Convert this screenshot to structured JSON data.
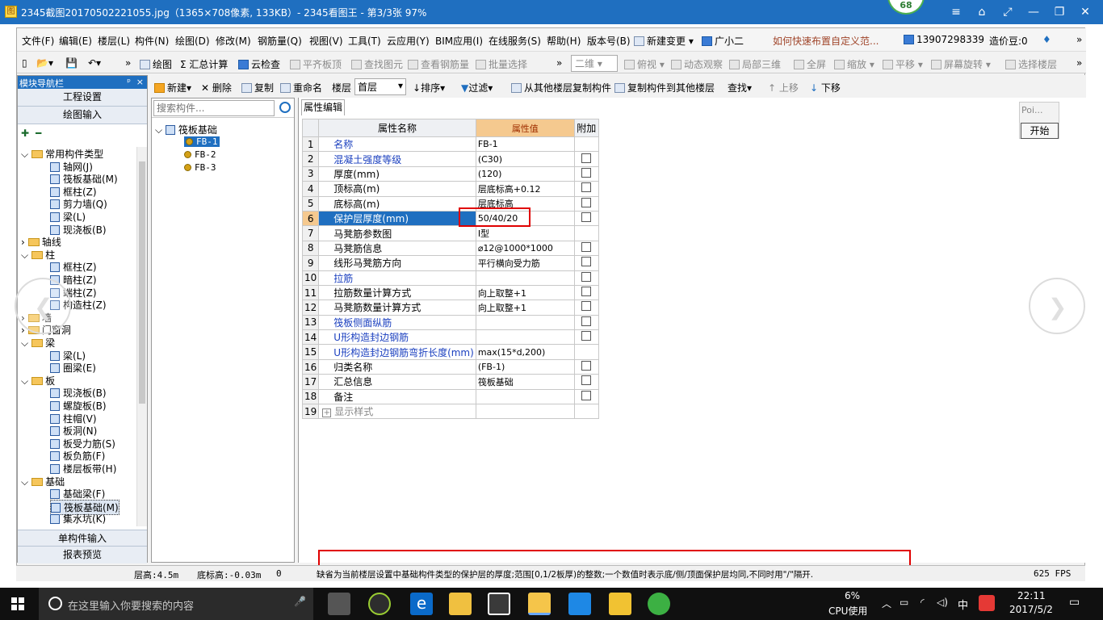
{
  "viewer": {
    "title": "2345截图20170502221055.jpg（1365×708像素, 133KB）- 2345看图王 - 第3/3张 97%",
    "badge": "68",
    "controls": [
      "≡",
      "⌂",
      "⤢",
      "—",
      "❐",
      "✕"
    ]
  },
  "menubar": {
    "items": [
      "文件(F)",
      "编辑(E)",
      "楼层(L)",
      "构件(N)",
      "绘图(D)",
      "修改(M)",
      "钢筋量(Q)",
      "视图(V)",
      "工具(T)",
      "云应用(Y)",
      "BIM应用(I)",
      "在线服务(S)",
      "帮助(H)",
      "版本号(B)"
    ],
    "new_change": "新建变更",
    "assistant": "广小二",
    "tip_link": "如何快速布置自定义范...",
    "phone": "13907298339",
    "coins": "造价豆:0"
  },
  "toolbar1": {
    "items": [
      "绘图",
      "Σ 汇总计算",
      "云检查",
      "平齐板顶",
      "查找图元",
      "查看钢筋量",
      "批量选择"
    ],
    "view_select": "二维",
    "view_items": [
      "俯视",
      "动态观察",
      "局部三维",
      "全屏",
      "缩放",
      "平移",
      "屏幕旋转",
      "选择楼层"
    ]
  },
  "nav": {
    "title": "模块导航栏",
    "pin": "ᵖ",
    "close": "×",
    "btn_project": "工程设置",
    "btn_draw": "绘图输入",
    "tree": [
      {
        "label": "常用构件类型",
        "kind": "folder",
        "level": 0,
        "toggle": "⌵"
      },
      {
        "label": "轴网(J)",
        "kind": "item",
        "level": 1
      },
      {
        "label": "筏板基础(M)",
        "kind": "item",
        "level": 1
      },
      {
        "label": "框柱(Z)",
        "kind": "item",
        "level": 1
      },
      {
        "label": "剪力墙(Q)",
        "kind": "item",
        "level": 1
      },
      {
        "label": "梁(L)",
        "kind": "item",
        "level": 1
      },
      {
        "label": "现浇板(B)",
        "kind": "item",
        "level": 1
      },
      {
        "label": "轴线",
        "kind": "folder",
        "level": 0,
        "toggle": "›"
      },
      {
        "label": "柱",
        "kind": "folder",
        "level": 0,
        "toggle": "⌵"
      },
      {
        "label": "框柱(Z)",
        "kind": "item",
        "level": 1
      },
      {
        "label": "暗柱(Z)",
        "kind": "item",
        "level": 1
      },
      {
        "label": "端柱(Z)",
        "kind": "item",
        "level": 1
      },
      {
        "label": "构造柱(Z)",
        "kind": "item",
        "level": 1
      },
      {
        "label": "墙",
        "kind": "folder",
        "level": 0,
        "toggle": "›"
      },
      {
        "label": "门窗洞",
        "kind": "folder",
        "level": 0,
        "toggle": "›"
      },
      {
        "label": "梁",
        "kind": "folder",
        "level": 0,
        "toggle": "⌵"
      },
      {
        "label": "梁(L)",
        "kind": "item",
        "level": 1
      },
      {
        "label": "圈梁(E)",
        "kind": "item",
        "level": 1
      },
      {
        "label": "板",
        "kind": "folder",
        "level": 0,
        "toggle": "⌵"
      },
      {
        "label": "现浇板(B)",
        "kind": "item",
        "level": 1
      },
      {
        "label": "螺旋板(B)",
        "kind": "item",
        "level": 1
      },
      {
        "label": "柱帽(V)",
        "kind": "item",
        "level": 1
      },
      {
        "label": "板洞(N)",
        "kind": "item",
        "level": 1
      },
      {
        "label": "板受力筋(S)",
        "kind": "item",
        "level": 1
      },
      {
        "label": "板负筋(F)",
        "kind": "item",
        "level": 1
      },
      {
        "label": "楼层板带(H)",
        "kind": "item",
        "level": 1
      },
      {
        "label": "基础",
        "kind": "folder",
        "level": 0,
        "toggle": "⌵"
      },
      {
        "label": "基础梁(F)",
        "kind": "item",
        "level": 1
      },
      {
        "label": "筏板基础(M)",
        "kind": "item",
        "level": 1,
        "selected": true
      },
      {
        "label": "集水坑(K)",
        "kind": "item",
        "level": 1
      }
    ],
    "btn_single": "单构件输入",
    "btn_report": "报表预览"
  },
  "toolbar2": {
    "items": [
      "新建",
      "删除",
      "复制",
      "重命名"
    ],
    "floor_label": "楼层",
    "floor_value": "首层",
    "sort": "排序",
    "filter": "过滤",
    "copy_from": "从其他楼层复制构件",
    "copy_to": "复制构件到其他楼层",
    "find": "查找",
    "up": "上移",
    "down": "下移"
  },
  "component_list": {
    "search_placeholder": "搜索构件...",
    "root": "筏板基础",
    "items": [
      "FB-1",
      "FB-2",
      "FB-3"
    ]
  },
  "props": {
    "tab": "属性编辑",
    "headers": [
      "属性名称",
      "属性值",
      "附加"
    ],
    "rows": [
      {
        "n": "1",
        "name": "名称",
        "value": "FB-1",
        "blue": true,
        "cb": false
      },
      {
        "n": "2",
        "name": "混凝土强度等级",
        "value": "(C30)",
        "blue": true,
        "cb": true
      },
      {
        "n": "3",
        "name": "厚度(mm)",
        "value": "(120)",
        "blue": false,
        "cb": true
      },
      {
        "n": "4",
        "name": "顶标高(m)",
        "value": "层底标高+0.12",
        "blue": false,
        "cb": true
      },
      {
        "n": "5",
        "name": "底标高(m)",
        "value": "层底标高",
        "blue": false,
        "cb": true
      },
      {
        "n": "6",
        "name": "保护层厚度(mm)",
        "value": "50/40/20",
        "blue": false,
        "cb": true,
        "selected": true
      },
      {
        "n": "7",
        "name": "马凳筋参数图",
        "value": "Ⅰ型",
        "blue": false,
        "cb": false
      },
      {
        "n": "8",
        "name": "马凳筋信息",
        "value": "⌀12@1000*1000",
        "blue": false,
        "cb": true
      },
      {
        "n": "9",
        "name": "线形马凳筋方向",
        "value": "平行横向受力筋",
        "blue": false,
        "cb": true
      },
      {
        "n": "10",
        "name": "拉筋",
        "value": "",
        "blue": true,
        "cb": true
      },
      {
        "n": "11",
        "name": "拉筋数量计算方式",
        "value": "向上取整+1",
        "blue": false,
        "cb": true
      },
      {
        "n": "12",
        "name": "马凳筋数量计算方式",
        "value": "向上取整+1",
        "blue": false,
        "cb": true
      },
      {
        "n": "13",
        "name": "筏板侧面纵筋",
        "value": "",
        "blue": true,
        "cb": true
      },
      {
        "n": "14",
        "name": "U形构造封边钢筋",
        "value": "",
        "blue": true,
        "cb": true
      },
      {
        "n": "15",
        "name": "U形构造封边钢筋弯折长度(mm)",
        "value": "max(15*d,200)",
        "blue": true,
        "cb": false
      },
      {
        "n": "16",
        "name": "归类名称",
        "value": "(FB-1)",
        "blue": false,
        "cb": true
      },
      {
        "n": "17",
        "name": "汇总信息",
        "value": "筏板基础",
        "blue": false,
        "cb": true
      },
      {
        "n": "18",
        "name": "备注",
        "value": "",
        "blue": false,
        "cb": true
      },
      {
        "n": "19",
        "name": "显示样式",
        "value": "",
        "blue": false,
        "cb": false,
        "expand": "+"
      }
    ]
  },
  "floatbox": {
    "field": "Poi...",
    "button": "开始"
  },
  "status": {
    "floor_height": "层高:4.5m",
    "bottom_elev": "底标高:-0.03m",
    "zero": "0",
    "hint": "缺省为当前楼层设置中基础构件类型的保护层的厚度;范围[0,1/2板厚)的整数;一个数值时表示底/侧/顶面保护层均同,不同时用\"/\"隔开.",
    "fps": "625 FPS"
  },
  "taskbar": {
    "search": "在这里输入你要搜索的内容",
    "cpu_percent": "6%",
    "cpu_label": "CPU使用",
    "ime": "中",
    "time": "22:11",
    "date": "2017/5/2"
  }
}
